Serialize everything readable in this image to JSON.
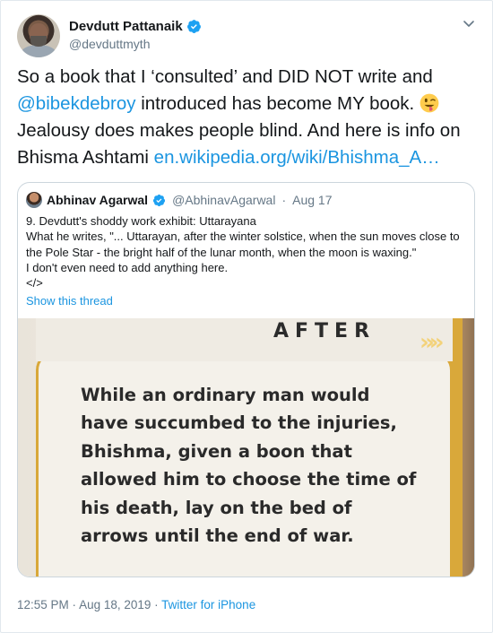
{
  "author": {
    "display_name": "Devdutt Pattanaik",
    "handle": "@devduttmyth"
  },
  "tweet": {
    "text_1": "So a book that I ‘consulted’ and DID NOT write and ",
    "mention": "@bibekdebroy",
    "text_2": " introduced has become MY book. ",
    "emoji_name": "winking-face-with-tongue-emoji",
    "text_3": " Jealousy does makes people blind. And here is info on Bhisma Ashtami ",
    "link": "en.wikipedia.org/wiki/Bhishma_A…"
  },
  "quote": {
    "display_name": "Abhinav Agarwal",
    "handle": "@AbhinavAgarwal",
    "separator": "·",
    "date": "Aug 17",
    "line_1": "9. Devdutt's shoddy work exhibit: Uttarayana",
    "line_2": "What he writes, \"... Uttarayan, after the winter solstice, when the sun moves close to the Pole Star - the bright half of the lunar month, when the moon is waxing.\"",
    "line_3": "I don't even need to add anything here.",
    "line_4": "</>",
    "show_thread": "Show this thread",
    "image": {
      "heading": "AFTER",
      "arrows": "»",
      "text": "While an ordinary man would have succumbed to the injuries, Bhishma, given a boon that allowed him to choose the time of his death, lay on the bed of arrows until the end of war."
    }
  },
  "meta": {
    "time": "12:55 PM",
    "separator_1": " · ",
    "date": "Aug 18, 2019",
    "separator_2": " · ",
    "source": "Twitter for iPhone"
  },
  "colors": {
    "link": "#1b95e0",
    "secondary_text": "#657786",
    "verified": "#1da1f2",
    "book_accent": "#d9a83a"
  }
}
